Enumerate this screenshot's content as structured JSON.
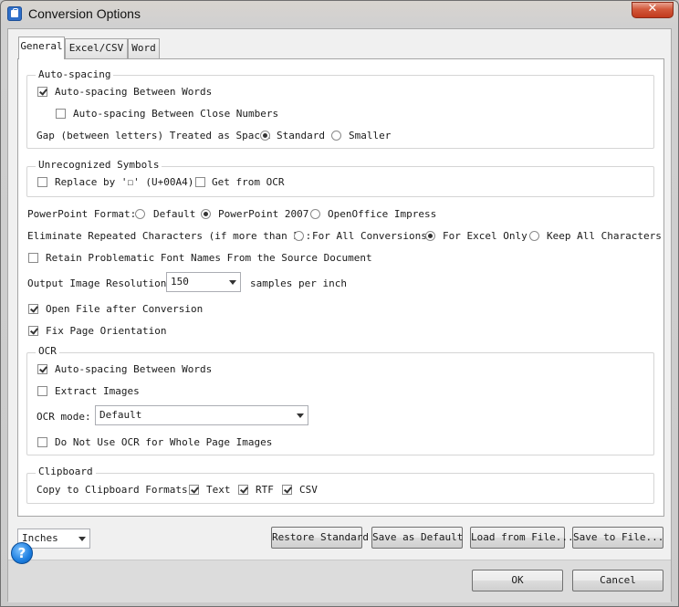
{
  "window": {
    "title": "Conversion Options",
    "close_label": "✕"
  },
  "tabs": [
    "General",
    "Excel/CSV",
    "Word"
  ],
  "autospacing": {
    "group_label": "Auto-spacing",
    "between_words": "Auto-spacing Between Words",
    "between_words_checked": true,
    "close_numbers": "Auto-spacing Between Close Numbers",
    "close_numbers_checked": false,
    "gap_label": "Gap (between letters) Treated as Space:",
    "standard": "Standard",
    "smaller": "Smaller",
    "gap_selected": "Standard"
  },
  "unrecognized": {
    "group_label": "Unrecognized Symbols",
    "replace": "Replace by '☐' (U+00A4)",
    "replace_checked": false,
    "ocr": "Get from OCR",
    "ocr_checked": false
  },
  "powerpoint": {
    "label": "PowerPoint Format:",
    "options": [
      "Default",
      "PowerPoint 2007",
      "OpenOffice Impress"
    ],
    "selected": "PowerPoint 2007"
  },
  "eliminate": {
    "label": "Eliminate Repeated Characters (if more than 5):",
    "options": [
      "For All Conversions",
      "For Excel Only",
      "Keep All Characters"
    ],
    "selected": "For Excel Only"
  },
  "retain_fonts": {
    "label": "Retain Problematic Font Names From the Source Document",
    "checked": false
  },
  "resolution": {
    "label": "Output Image Resolution:",
    "value": "150",
    "suffix": "samples per inch"
  },
  "open_after": {
    "label": "Open File after Conversion",
    "checked": true
  },
  "fix_orientation": {
    "label": "Fix Page Orientation",
    "checked": true
  },
  "ocr": {
    "group_label": "OCR",
    "autospacing": "Auto-spacing Between Words",
    "autospacing_checked": true,
    "extract": "Extract Images",
    "extract_checked": false,
    "mode_label": "OCR mode:",
    "mode_value": "Default",
    "no_ocr": "Do Not Use OCR for Whole Page Images",
    "no_ocr_checked": false
  },
  "clipboard": {
    "group_label": "Clipboard",
    "label": "Copy to Clipboard Formats:",
    "formats": [
      "Text",
      "RTF",
      "CSV"
    ],
    "checked": [
      true,
      true,
      true
    ]
  },
  "units": {
    "value": "Inches"
  },
  "buttons": {
    "restore": "Restore Standard",
    "save_default": "Save as Default",
    "load": "Load from File...",
    "save_file": "Save to File...",
    "ok": "OK",
    "cancel": "Cancel",
    "help": "?"
  }
}
